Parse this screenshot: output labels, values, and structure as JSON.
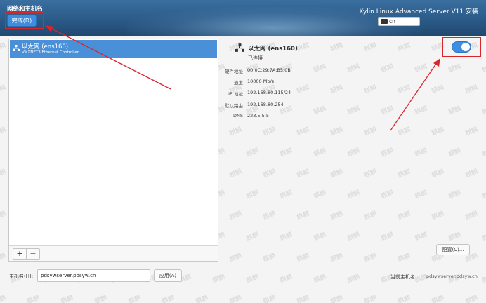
{
  "header": {
    "page_title": "网络和主机名",
    "done_button": "完成(D)",
    "installer_title": "Kylin Linux Advanced Server V11 安装",
    "keyboard_layout": "cn",
    "background_color": "#2b5a87"
  },
  "connections": [
    {
      "name": "以太网 (ens160)",
      "device": "VMXNET3 Ethernet Controller",
      "icon": "network-wired-icon",
      "selected": true
    }
  ],
  "list_toolbar": {
    "add_label": "+",
    "remove_label": "−"
  },
  "details": {
    "name": "以太网 (ens160)",
    "status": "已连接",
    "icon": "network-wired-icon",
    "toggle_on": true,
    "properties": [
      {
        "label": "硬件地址",
        "value": "00:0C:29:7A:B5:0B"
      },
      {
        "label": "速度",
        "value": "10000 Mb/s"
      },
      {
        "label": "IP 地址",
        "value": "192.168.80.115/24"
      },
      {
        "label": "默认路由",
        "value": "192.168.80.254"
      },
      {
        "label": "DNS",
        "value": "223.5.5.5"
      }
    ],
    "configure_button": "配置(C)..."
  },
  "hostname": {
    "label": "主机名(H):",
    "value": "pdsywserver.pdsyw.cn",
    "apply_button": "应用(A)",
    "current_label": "当前主机名:",
    "current_value": "pdsywserver.pdsyw.cn"
  },
  "watermark_text": "麒麟",
  "colors": {
    "accent": "#4a90d9",
    "annotation": "#d9262c"
  }
}
